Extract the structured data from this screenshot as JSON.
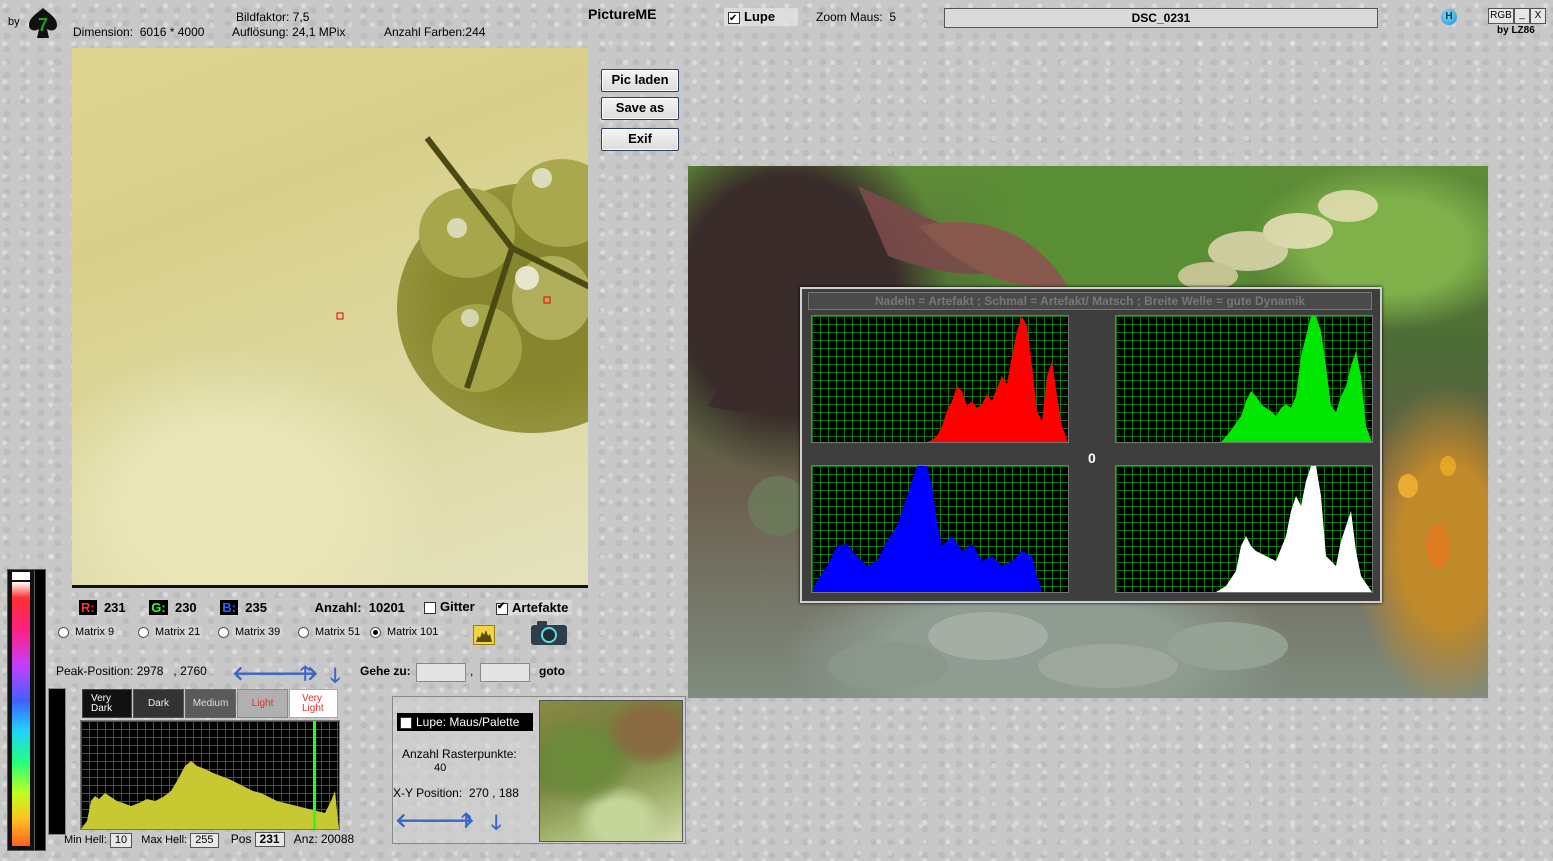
{
  "header": {
    "by_label": "by",
    "app_title": "PictureME",
    "dimension_label": "Dimension:",
    "dimension_value": "6016 * 4000",
    "bildfaktor_label": "Bildfaktor:",
    "bildfaktor_value": "7,5",
    "aufloesung_label": "Auflösung:",
    "aufloesung_value": "24,1 MPix",
    "farben_label": "Anzahl Farben:",
    "farben_value": "244",
    "lupe_label": "Lupe",
    "zoom_label": "Zoom Maus:",
    "zoom_value": "5",
    "filename": "DSC_0231",
    "rgb_button": "RGB",
    "minimize_button": "_",
    "close_button": "X",
    "byline": "by LZ86",
    "help_icon_letter": "H"
  },
  "buttons": {
    "pic_laden": "Pic laden",
    "save_as": "Save as",
    "exif": "Exif"
  },
  "rgb_readout": {
    "r_label": "R:",
    "r_value": "231",
    "g_label": "G:",
    "g_value": "230",
    "b_label": "B:",
    "b_value": "235",
    "anzahl_label": "Anzahl:",
    "anzahl_value": "10201",
    "gitter_label": "Gitter",
    "artefakte_label": "Artefakte"
  },
  "matrix_options": [
    {
      "label": "Matrix 9",
      "selected": false
    },
    {
      "label": "Matrix 21",
      "selected": false
    },
    {
      "label": "Matrix 39",
      "selected": false
    },
    {
      "label": "Matrix 51",
      "selected": false
    },
    {
      "label": "Matrix 101",
      "selected": true
    }
  ],
  "peak": {
    "label": "Peak-Position:",
    "x": "2978",
    "y": "2760"
  },
  "goto": {
    "label": "Gehe zu:",
    "separator": ",",
    "button": "goto",
    "x_value": "",
    "y_value": ""
  },
  "brightness_tabs": {
    "very_dark": "Very Dark",
    "dark": "Dark",
    "medium": "Medium",
    "light": "Light",
    "very_light": "Very Light"
  },
  "bottom_stats": {
    "min_label": "Min Hell:",
    "min_value": "10",
    "max_label": "Max Hell:",
    "max_value": "255",
    "pos_label": "Pos",
    "pos_value": "231",
    "anz_label": "Anz:",
    "anz_value": "20088"
  },
  "lupe_panel": {
    "checkbox_label": "Lupe: Maus/Palette",
    "raster_label": "Anzahl Rasterpunkte:",
    "raster_value": "40",
    "xy_label": "X-Y Position:",
    "xy_value": "270 , 188"
  },
  "histogram_panel": {
    "title": "Nadeln = Artefakt ; Schmal = Artefakt/ Matsch  ;  Breite Welle = gute Dynamik",
    "center_value": "0"
  },
  "colors": {
    "red": "#ff0000",
    "green": "#00e600",
    "blue": "#0000ff",
    "white": "#ffffff",
    "yellow_histo": "#c8c832"
  }
}
